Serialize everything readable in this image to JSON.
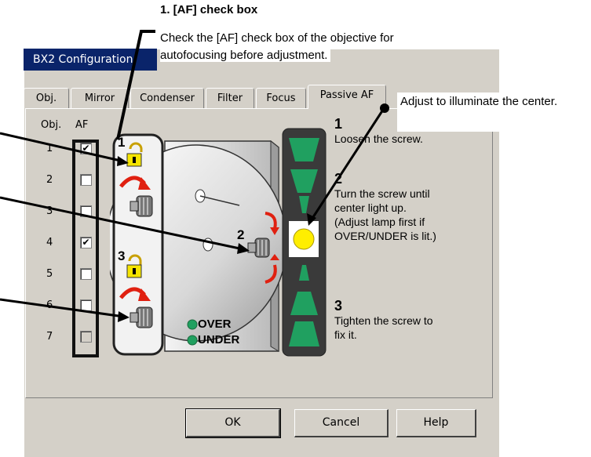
{
  "annotation": {
    "header": "1. [AF] check box",
    "text_line1": "Check the [AF] check box of the objective for",
    "text_line2": "autofocusing before adjustment.",
    "callout": "Adjust to illuminate the center."
  },
  "window": {
    "title": "BX2 Configuration"
  },
  "tabs": [
    {
      "label": "Obj."
    },
    {
      "label": "Mirror"
    },
    {
      "label": "Condenser"
    },
    {
      "label": "Filter"
    },
    {
      "label": "Focus"
    },
    {
      "label": "Passive AF"
    }
  ],
  "active_tab": "Passive AF",
  "columns": {
    "obj": "Obj.",
    "af": "AF"
  },
  "objectives": [
    {
      "num": "1",
      "af": true
    },
    {
      "num": "2",
      "af": false
    },
    {
      "num": "3",
      "af": false
    },
    {
      "num": "4",
      "af": true
    },
    {
      "num": "5",
      "af": false
    },
    {
      "num": "6",
      "af": false
    },
    {
      "num": "7",
      "af": false,
      "disabled": true
    }
  ],
  "illustration": {
    "num1": "1",
    "num2": "2",
    "num3": "3",
    "over": "OVER",
    "under": "UNDER"
  },
  "steps": {
    "s1_num": "1",
    "s1_text": "Loosen the screw.",
    "s2_num": "2",
    "s2_line1": "Turn the screw until",
    "s2_line2": "center light up.",
    "s2_line3": "(Adjust lamp first if",
    "s2_line4": "OVER/UNDER is lit.)",
    "s3_num": "3",
    "s3_line1": "Tighten the screw to",
    "s3_line2": "fix it."
  },
  "buttons": {
    "ok": "OK",
    "cancel": "Cancel",
    "help": "Help"
  },
  "colors": {
    "titlebar": "#0a246a",
    "indicator_green": "#20a060",
    "indicator_dark": "#3a3a3a",
    "center_light": "#ffee00",
    "lock_yellow": "#f5e400",
    "arrow_red": "#e02010"
  }
}
